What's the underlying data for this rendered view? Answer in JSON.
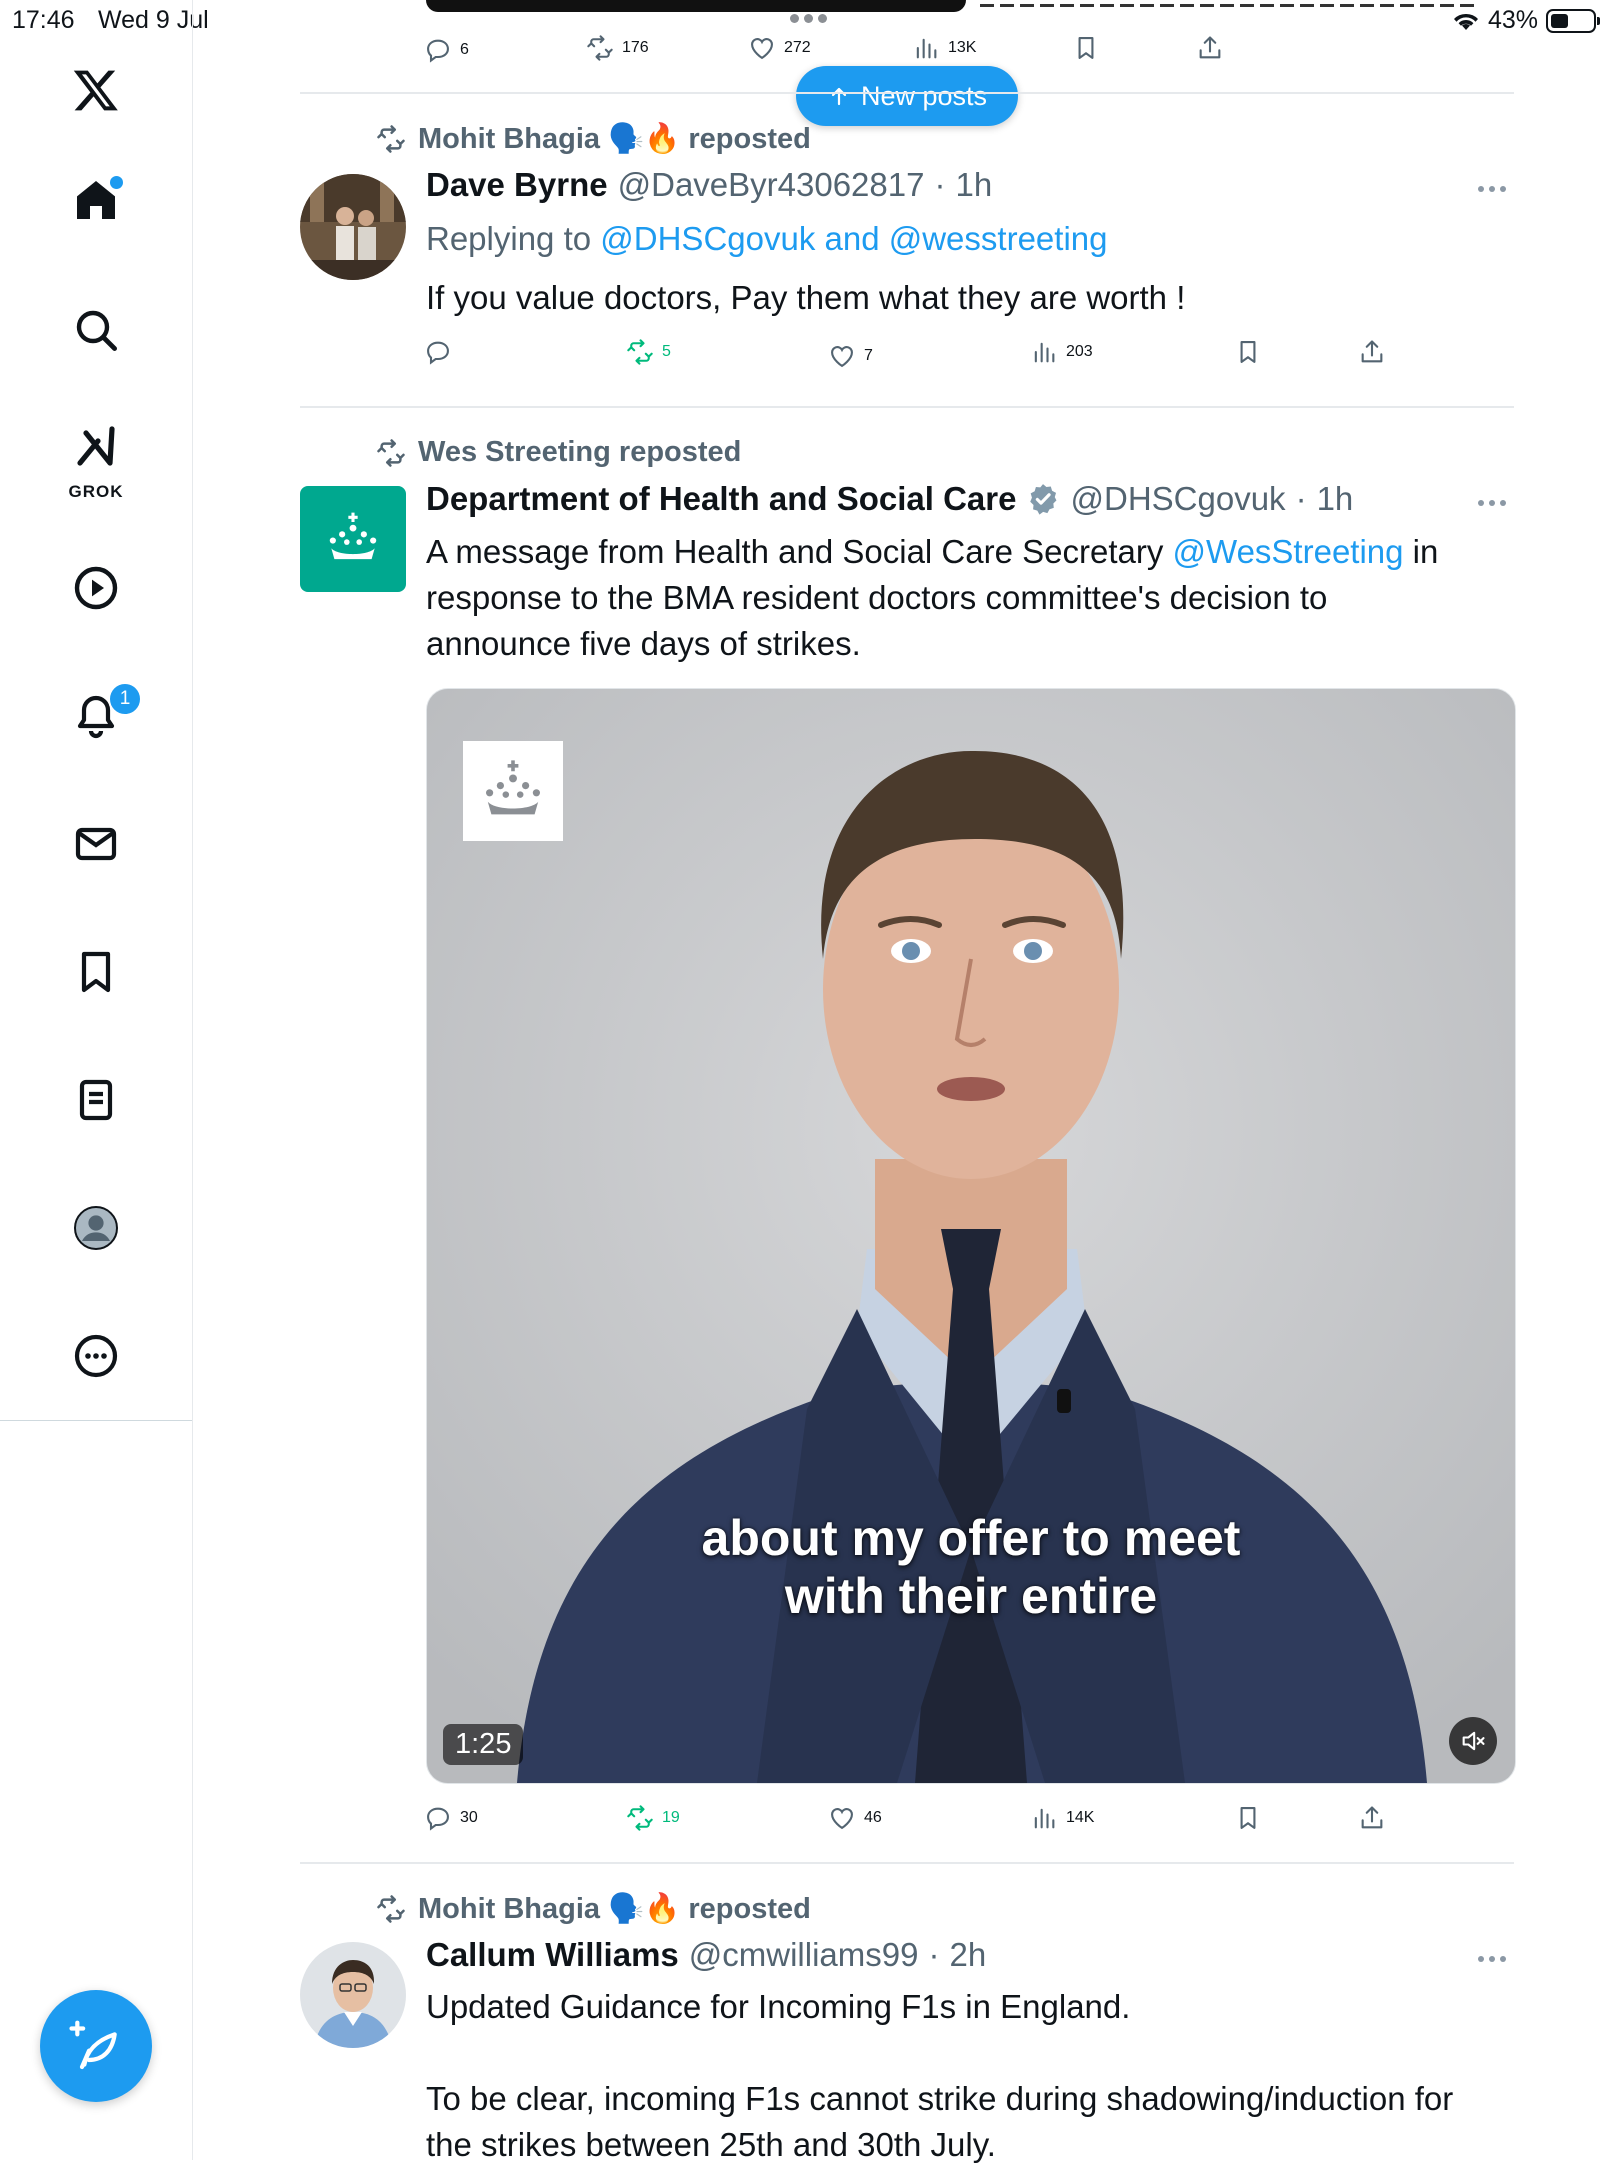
{
  "status_bar": {
    "time": "17:46",
    "date": "Wed 9 Jul",
    "battery": "43%"
  },
  "sidebar": {
    "logo": "x-logo-icon",
    "grok_label": "GROK",
    "notifications_badge": "1",
    "items": [
      "home-icon",
      "search-icon",
      "grok-icon",
      "video-icon",
      "notifications-icon",
      "messages-icon",
      "bookmarks-icon",
      "lists-icon",
      "profile-icon",
      "more-icon"
    ]
  },
  "new_posts_label": "New posts",
  "top_post_actions": {
    "replies": "6",
    "reposts": "176",
    "likes": "272",
    "views": "13K"
  },
  "posts": [
    {
      "repost_by": "Mohit Bhagia 🗣️🔥 reposted",
      "name": "Dave Byrne",
      "handle": "@DaveByr43062817",
      "time": "1h",
      "replying_prefix": "Replying to ",
      "replying_to": "@DHSCgovuk and @wesstreeting",
      "text": "If you value doctors, Pay them what they are worth !",
      "replies": "",
      "reposts": "5",
      "likes": "7",
      "views": "203"
    },
    {
      "repost_by": "Wes Streeting reposted",
      "name": "Department of Health and Social Care",
      "handle": "@DHSCgovuk",
      "time": "1h",
      "text_before": "A message from Health and Social Care Secretary ",
      "text_mention": "@WesStreeting",
      "text_after_1": " in",
      "text_line2": "response to the BMA resident doctors committee's decision to",
      "text_line3": "announce five days of strikes.",
      "video_caption_1": "about my offer to meet",
      "video_caption_2": "with their entire",
      "video_duration": "1:25",
      "replies": "30",
      "reposts": "19",
      "likes": "46",
      "views": "14K"
    },
    {
      "repost_by": "Mohit Bhagia 🗣️🔥 reposted",
      "name": "Callum Williams",
      "handle": "@cmwilliams99",
      "time": "2h",
      "text_line1": "Updated Guidance for Incoming F1s in England.",
      "text_line2": "To be clear, incoming F1s cannot strike during shadowing/induction for",
      "text_line3": "the strikes between 25th and 30th July."
    }
  ],
  "colors": {
    "accent": "#1d9bf0",
    "repost_green": "#00ba7c",
    "dhsc_green": "#00a88f",
    "muted": "#536471"
  }
}
